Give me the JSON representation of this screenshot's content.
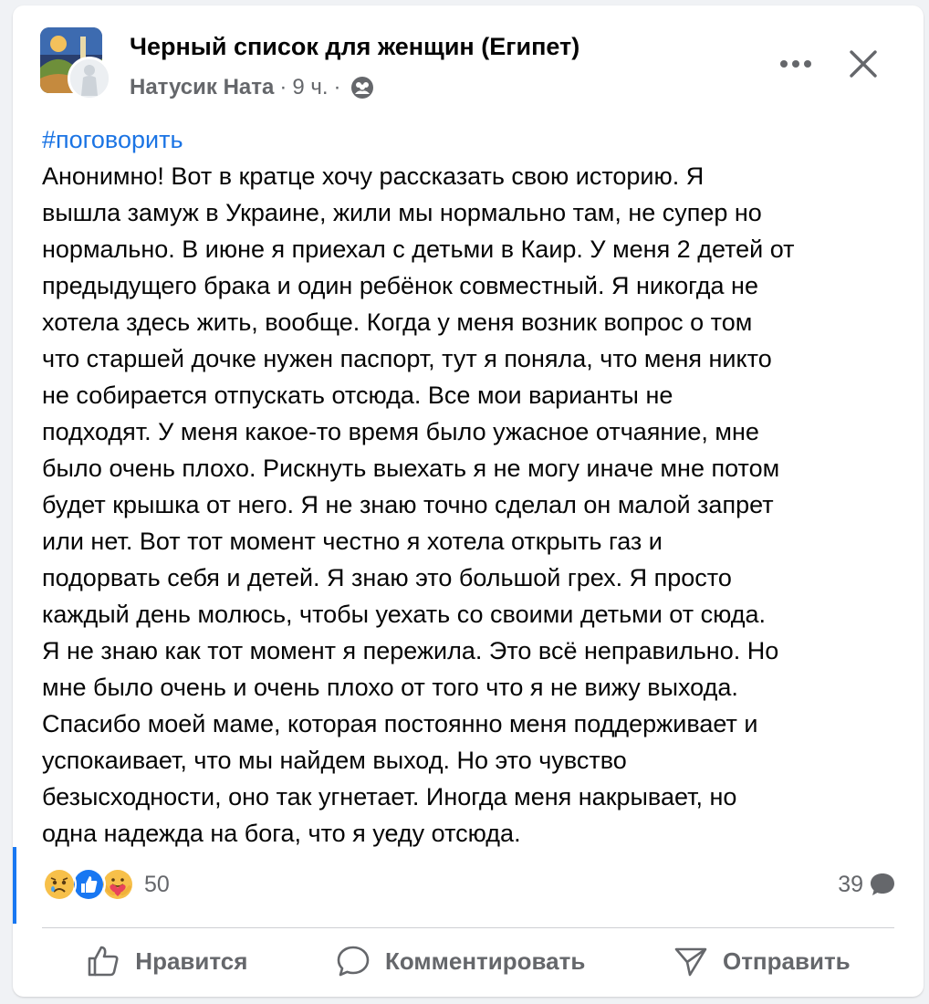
{
  "header": {
    "group_name": "Черный список для женщин (Египет)",
    "author": "Натусик Ната",
    "separator": "·",
    "time": "9 ч.",
    "audience_icon": "group-members-icon",
    "more_icon": "more-horizontal-icon",
    "close_icon": "close-icon"
  },
  "post": {
    "hashtag": "#поговорить",
    "lines": [
      "Анонимно! Вот в кратце хочу рассказать свою историю. Я",
      "вышла замуж в Украине, жили мы нормально там, не супер но",
      "нормально. В июне я приехал с детьми в Каир. У меня 2 детей от",
      "предыдущего брака и один ребёнок совместный. Я никогда не",
      "хотела здесь жить, вообще. Когда у меня возник вопрос о том",
      "что старшей дочке нужен паспорт, тут я поняла, что меня никто",
      "не собирается отпускать отсюда. Все мои варианты не",
      "подходят. У меня какое-то время было ужасное отчаяние, мне",
      "было очень плохо. Рискнуть выехать я не могу иначе мне потом",
      "будет крышка от него. Я не знаю точно сделал он малой запрет",
      "или нет. Вот тот момент честно я хотела открыть газ и",
      "подорвать себя и детей. Я знаю это большой грех. Я просто",
      "каждый день молюсь, чтобы уехать со своими детьми от сюда.",
      "Я не знаю как тот момент я пережила. Это всё неправильно. Но",
      "мне было очень и очень плохо от того что я не вижу выхода.",
      "Спасибо моей маме, которая постоянно меня поддерживает и",
      "успокаивает, что мы найдем выход. Но это чувство",
      "безысходности, оно так угнетает. Иногда меня накрывает, но",
      "одна надежда на бога, что я уеду отсюда."
    ]
  },
  "reactions": {
    "icons": [
      "sad-reaction-icon",
      "like-reaction-icon",
      "care-reaction-icon"
    ],
    "count": "50"
  },
  "comments": {
    "count": "39",
    "icon": "comment-bubble-icon"
  },
  "actions": {
    "like": "Нравится",
    "comment": "Комментировать",
    "share": "Отправить"
  },
  "colors": {
    "accent": "#1877f2",
    "hashtag": "#1b74e4",
    "secondary_text": "#65676b"
  }
}
